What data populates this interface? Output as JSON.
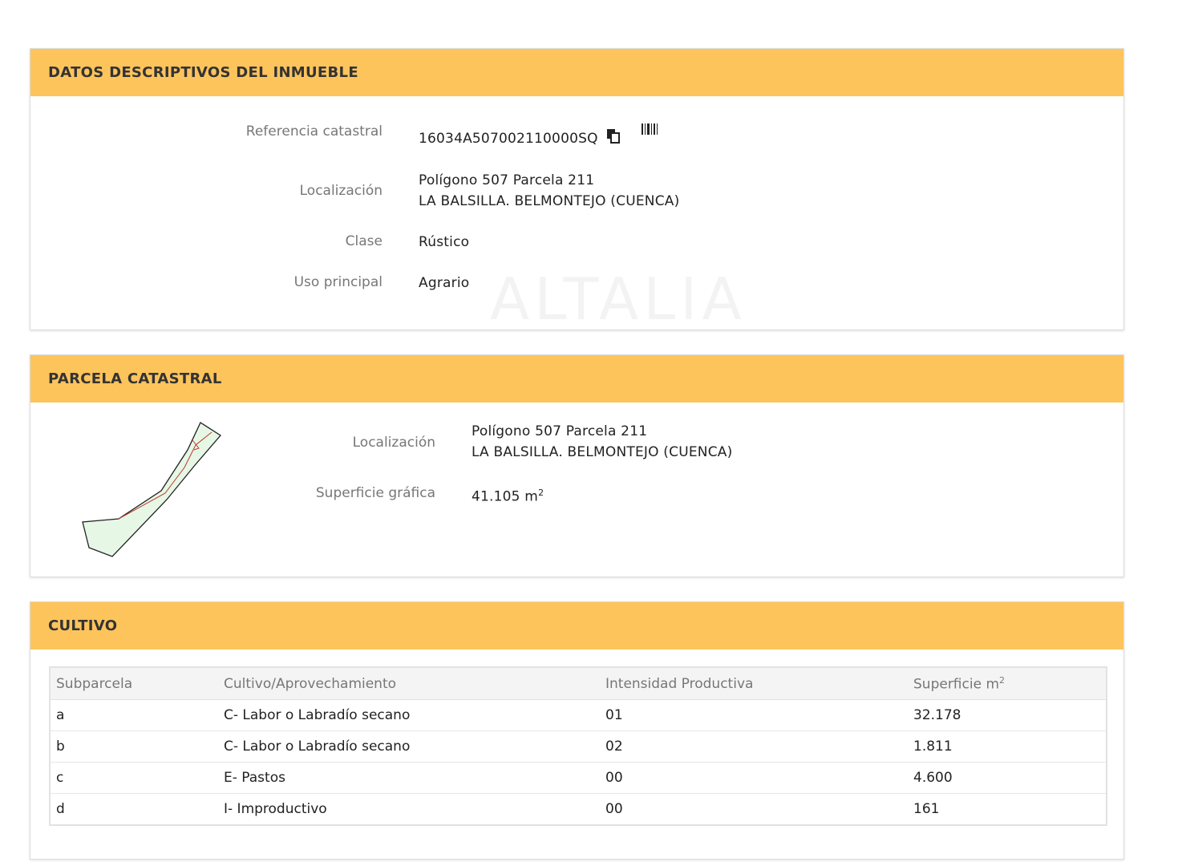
{
  "datos": {
    "title": "DATOS DESCRIPTIVOS DEL INMUEBLE",
    "ref_label": "Referencia catastral",
    "ref_value": "16034A507002110000SQ",
    "copy_icon": "copy-icon",
    "barcode_icon": "barcode-icon",
    "loc_label": "Localización",
    "loc_line1": "Polígono 507 Parcela 211",
    "loc_line2": "LA BALSILLA. BELMONTEJO (CUENCA)",
    "clase_label": "Clase",
    "clase_value": "Rústico",
    "uso_label": "Uso principal",
    "uso_value": "Agrario"
  },
  "parcela": {
    "title": "PARCELA CATASTRAL",
    "loc_label": "Localización",
    "loc_line1": "Polígono 507 Parcela 211",
    "loc_line2": "LA BALSILLA. BELMONTEJO (CUENCA)",
    "sup_label": "Superficie gráfica",
    "sup_value": "41.105 m",
    "sup_unit_exp": "2"
  },
  "cultivo": {
    "title": "CULTIVO",
    "headers": [
      "Subparcela",
      "Cultivo/Aprovechamiento",
      "Intensidad Productiva",
      "Superficie m"
    ],
    "header_exp": "2",
    "rows": [
      [
        "a",
        "C- Labor o Labradío secano",
        "01",
        "32.178"
      ],
      [
        "b",
        "C- Labor o Labradío secano",
        "02",
        "1.811"
      ],
      [
        "c",
        "E- Pastos",
        "00",
        "4.600"
      ],
      [
        "d",
        "I- Improductivo",
        "00",
        "161"
      ]
    ]
  },
  "colors": {
    "header_bg": "#fdc45c",
    "parcel_fill": "#e6f7e6",
    "parcel_line": "#c0392b"
  }
}
